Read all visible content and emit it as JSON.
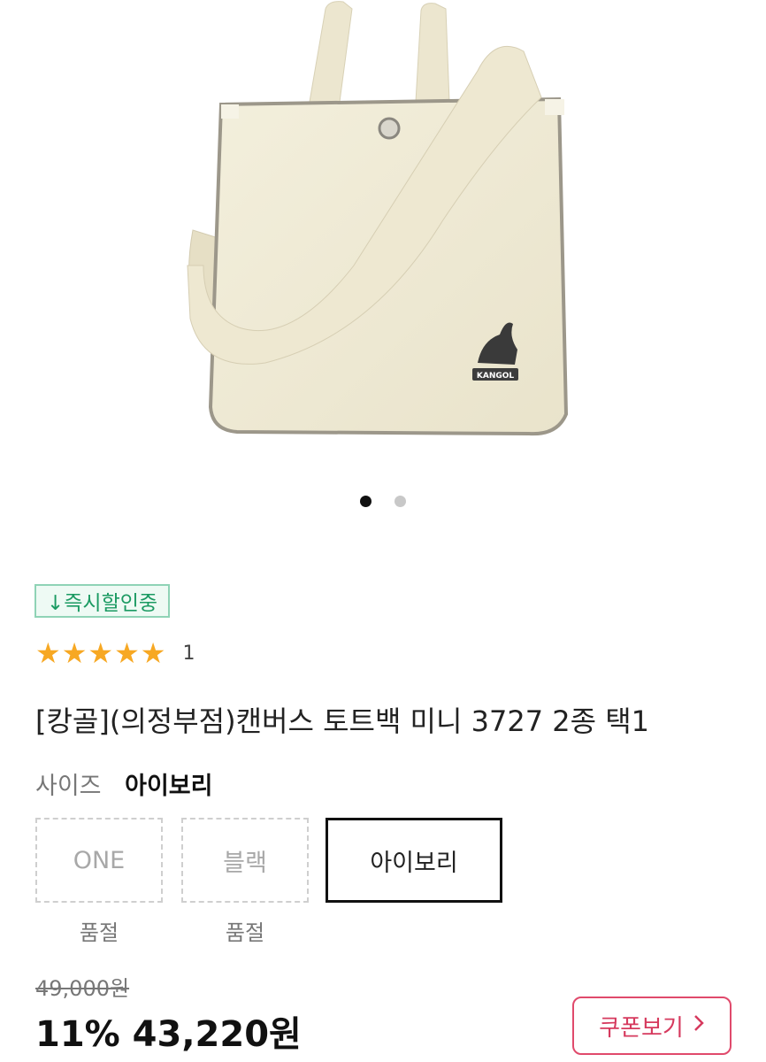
{
  "gallery": {
    "image_alt": "canvas tote bag",
    "logo_text": "KANGOL",
    "dots": [
      {
        "active": true
      },
      {
        "active": false
      }
    ]
  },
  "badge": {
    "icon": "arrow-down-icon",
    "label": "↓즉시할인중"
  },
  "rating": {
    "stars": "★★★★★",
    "score": 5,
    "count": "1"
  },
  "product": {
    "title": "[캉골](의정부점)캔버스 토트백 미니 3727 2종 택1"
  },
  "size": {
    "label": "사이즈",
    "selected": "아이보리",
    "options": [
      {
        "label": "ONE",
        "status": "품절"
      },
      {
        "label": "블랙",
        "status": "품절"
      },
      {
        "label": "아이보리",
        "status": ""
      }
    ]
  },
  "price": {
    "original": "49,000원",
    "final": "11% 43,220원"
  },
  "coupon": {
    "label": "쿠폰보기",
    "icon": "chevron-right-icon"
  },
  "colors": {
    "star": "#f7a823",
    "badge": "#1b9a62",
    "coupon": "#d63a5e"
  }
}
